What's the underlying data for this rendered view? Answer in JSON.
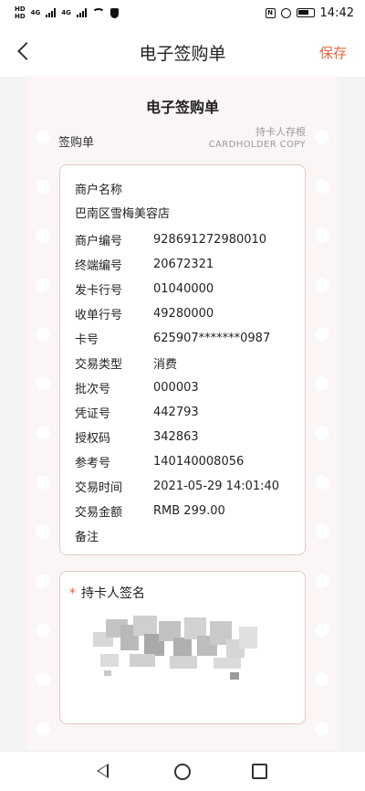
{
  "status_bar": {
    "left_tags": [
      "HD",
      "HD"
    ],
    "network_labels": [
      "4G",
      "4G"
    ],
    "nfc": "N",
    "time": "14:42"
  },
  "header": {
    "title": "电子签购单",
    "save_label": "保存"
  },
  "receipt": {
    "title": "电子签购单",
    "subtitle": "签购单",
    "copy_label_cn": "持卡人存根",
    "copy_label_en": "CARDHOLDER COPY",
    "merchant_label": "商户名称",
    "merchant_name": "巴南区雪梅美容店",
    "rows": [
      {
        "key": "商户编号",
        "value": "928691272980010"
      },
      {
        "key": "终端编号",
        "value": "20672321"
      },
      {
        "key": "发卡行号",
        "value": "01040000"
      },
      {
        "key": "收单行号",
        "value": "49280000"
      },
      {
        "key": "卡号",
        "value": "625907*******0987"
      },
      {
        "key": "交易类型",
        "value": "消费"
      },
      {
        "key": "批次号",
        "value": "000003"
      },
      {
        "key": "凭证号",
        "value": "442793"
      },
      {
        "key": "授权码",
        "value": "342863"
      },
      {
        "key": "参考号",
        "value": "140140008056"
      },
      {
        "key": "交易时间",
        "value": "2021-05-29 14:01:40"
      },
      {
        "key": "交易金额",
        "value": "RMB 299.00"
      },
      {
        "key": "备注",
        "value": ""
      }
    ],
    "signature_required_mark": "*",
    "signature_label": "持卡人签名"
  },
  "colors": {
    "accent": "#e8663d",
    "card_border": "#e3c9c5",
    "receipt_bg": "#fbf6f5"
  },
  "icons": {
    "back": "chevron-left-icon",
    "nav_back": "triangle-back-icon",
    "nav_home": "circle-home-icon",
    "nav_recent": "square-recent-icon"
  }
}
